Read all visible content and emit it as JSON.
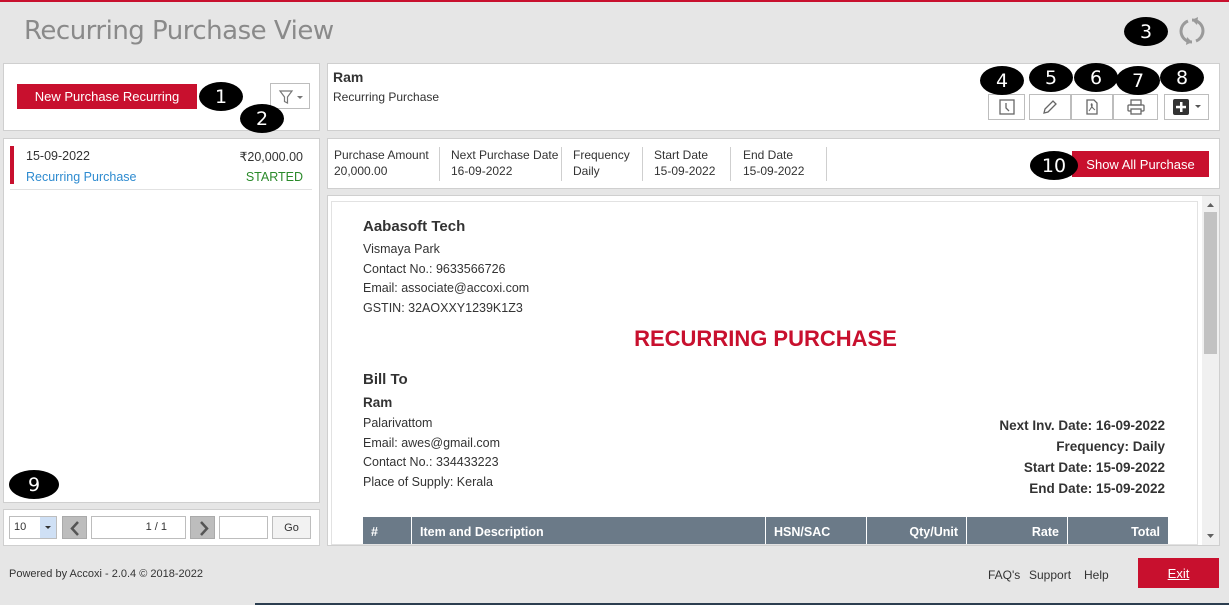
{
  "window": {
    "title": "Recurring Purchase View"
  },
  "markers": [
    "1",
    "2",
    "3",
    "4",
    "5",
    "6",
    "7",
    "8",
    "9",
    "10"
  ],
  "left_panel": {
    "new_button": "New Purchase Recurring",
    "list": [
      {
        "date": "15-09-2022",
        "amount": "₹20,000.00",
        "type": "Recurring Purchase",
        "status": "STARTED"
      }
    ],
    "pager": {
      "page_size": "10",
      "page": "1 / 1",
      "go": "Go"
    }
  },
  "detail_header": {
    "name": "Ram",
    "subtitle": "Recurring Purchase"
  },
  "summary": {
    "fields": [
      {
        "label": "Purchase Amount",
        "value": "20,000.00"
      },
      {
        "label": "Next Purchase Date",
        "value": "16-09-2022"
      },
      {
        "label": "Frequency",
        "value": "Daily"
      },
      {
        "label": "Start Date",
        "value": "15-09-2022"
      },
      {
        "label": "End Date",
        "value": "15-09-2022"
      }
    ],
    "show_all_button": "Show All Purchase"
  },
  "document": {
    "company": "Aabasoft Tech",
    "address": "Vismaya Park",
    "contact": "Contact No.: 9633566726",
    "email": "Email: associate@accoxi.com",
    "gstin": "GSTIN: 32AOXXY1239K1Z3",
    "heading": "RECURRING PURCHASE",
    "bill_to_label": "Bill To",
    "bill_name": "Ram",
    "bill_address": "Palarivattom",
    "bill_email": "Email: awes@gmail.com",
    "bill_contact": "Contact No.: 334433223",
    "bill_place": "Place of Supply: Kerala",
    "next_inv": "Next Inv. Date: 16-09-2022",
    "frequency": "Frequency: Daily",
    "start": "Start Date: 15-09-2022",
    "end": "End Date: 15-09-2022",
    "table_headers": [
      "#",
      "Item and Description",
      "HSN/SAC",
      "Qty/Unit",
      "Rate",
      "Total"
    ]
  },
  "footer": {
    "powered": "Powered by Accoxi - 2.0.4 © 2018-2022",
    "faq": "FAQ's",
    "support": "Support",
    "help": "Help",
    "exit": "Exit"
  },
  "colors": {
    "accent": "#c8102e",
    "link": "#2e8bd0",
    "status": "#2a8a2a",
    "table_header": "#6b7a88"
  }
}
